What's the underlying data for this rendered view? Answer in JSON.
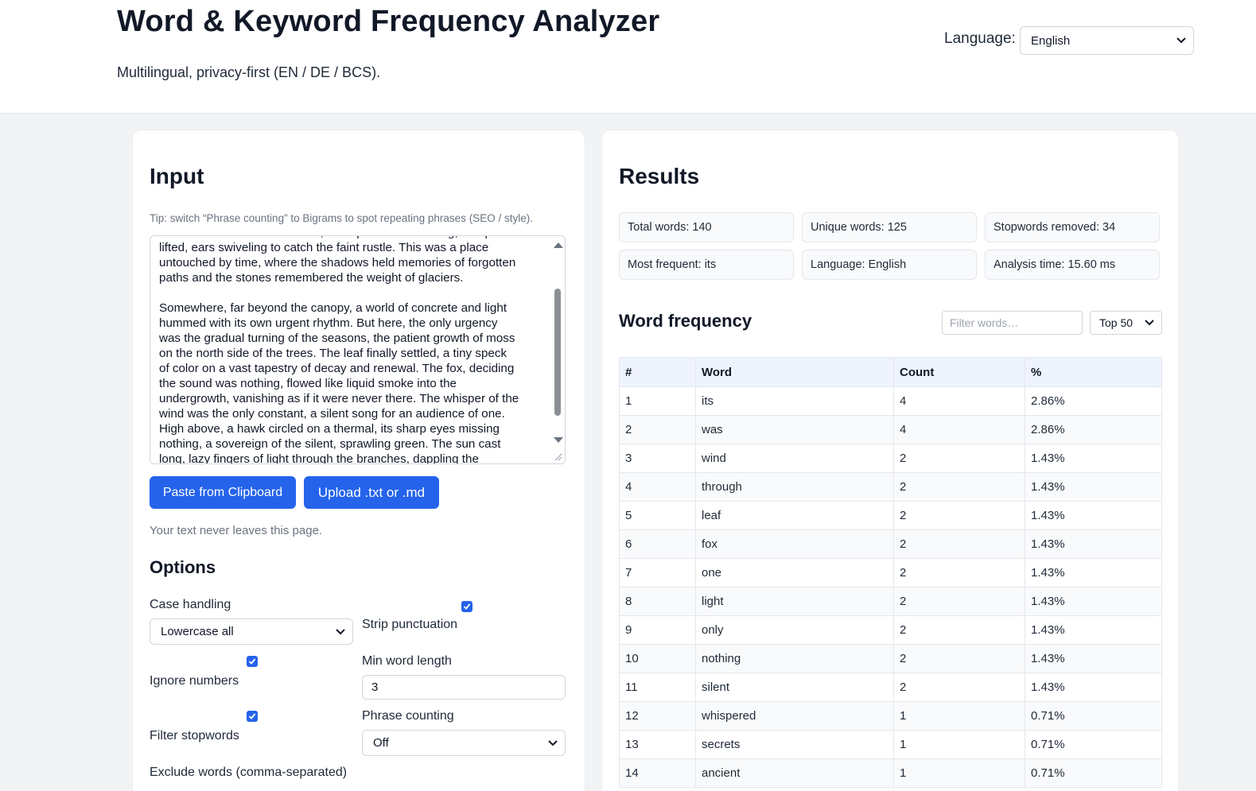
{
  "header": {
    "title": "Word & Keyword Frequency Analyzer",
    "subtitle": "Multilingual, privacy-first (EN / DE / BCS).",
    "language_label": "Language:",
    "language_value": "English"
  },
  "input": {
    "heading": "Input",
    "tip": "Tip: switch “Phrase counting” to Bigrams to spot repeating phrases (SEO / style).",
    "text": "towards the forest floor. Below, a fox paused its hunting, one paw\nlifted, ears swiveling to catch the faint rustle. This was a place\nuntouched by time, where the shadows held memories of forgotten\npaths and the stones remembered the weight of glaciers.\n\nSomewhere, far beyond the canopy, a world of concrete and light\nhummed with its own urgent rhythm. But here, the only urgency\nwas the gradual turning of the seasons, the patient growth of moss\non the north side of the trees. The leaf finally settled, a tiny speck\nof color on a vast tapestry of decay and renewal. The fox, deciding\nthe sound was nothing, flowed like liquid smoke into the\nundergrowth, vanishing as if it were never there. The whisper of the\nwind was the only constant, a silent song for an audience of one.\nHigh above, a hawk circled on a thermal, its sharp eyes missing\nnothing, a sovereign of the silent, sprawling green. The sun cast\nlong, lazy fingers of light through the branches, dappling the",
    "paste_button": "Paste from Clipboard",
    "upload_button": "Upload .txt or .md",
    "privacy_note": "Your text never leaves this page."
  },
  "options": {
    "heading": "Options",
    "case_label": "Case handling",
    "case_value": "Lowercase all",
    "strip_punct_label": "Strip punctuation",
    "ignore_numbers_label": "Ignore numbers",
    "min_len_label": "Min word length",
    "min_len_value": "3",
    "filter_stopwords_label": "Filter stopwords",
    "phrase_label": "Phrase counting",
    "phrase_value": "Off",
    "exclude_label": "Exclude words (comma-separated)"
  },
  "results": {
    "heading": "Results",
    "stats": {
      "total": "Total words: 140",
      "unique": "Unique words: 125",
      "stopwords": "Stopwords removed: 34",
      "most_frequent": "Most frequent: its",
      "language": "Language: English",
      "time": "Analysis time: 15.60 ms"
    },
    "freq_heading": "Word frequency",
    "filter_placeholder": "Filter words…",
    "top_value": "Top 50",
    "columns": [
      "#",
      "Word",
      "Count",
      "%"
    ],
    "rows": [
      [
        "1",
        "its",
        "4",
        "2.86%"
      ],
      [
        "2",
        "was",
        "4",
        "2.86%"
      ],
      [
        "3",
        "wind",
        "2",
        "1.43%"
      ],
      [
        "4",
        "through",
        "2",
        "1.43%"
      ],
      [
        "5",
        "leaf",
        "2",
        "1.43%"
      ],
      [
        "6",
        "fox",
        "2",
        "1.43%"
      ],
      [
        "7",
        "one",
        "2",
        "1.43%"
      ],
      [
        "8",
        "light",
        "2",
        "1.43%"
      ],
      [
        "9",
        "only",
        "2",
        "1.43%"
      ],
      [
        "10",
        "nothing",
        "2",
        "1.43%"
      ],
      [
        "11",
        "silent",
        "2",
        "1.43%"
      ],
      [
        "12",
        "whispered",
        "1",
        "0.71%"
      ],
      [
        "13",
        "secrets",
        "1",
        "0.71%"
      ],
      [
        "14",
        "ancient",
        "1",
        "0.71%"
      ]
    ]
  },
  "colors": {
    "accent": "#2563eb",
    "table_header": "#eef3fd",
    "background": "#f1f3f5"
  }
}
